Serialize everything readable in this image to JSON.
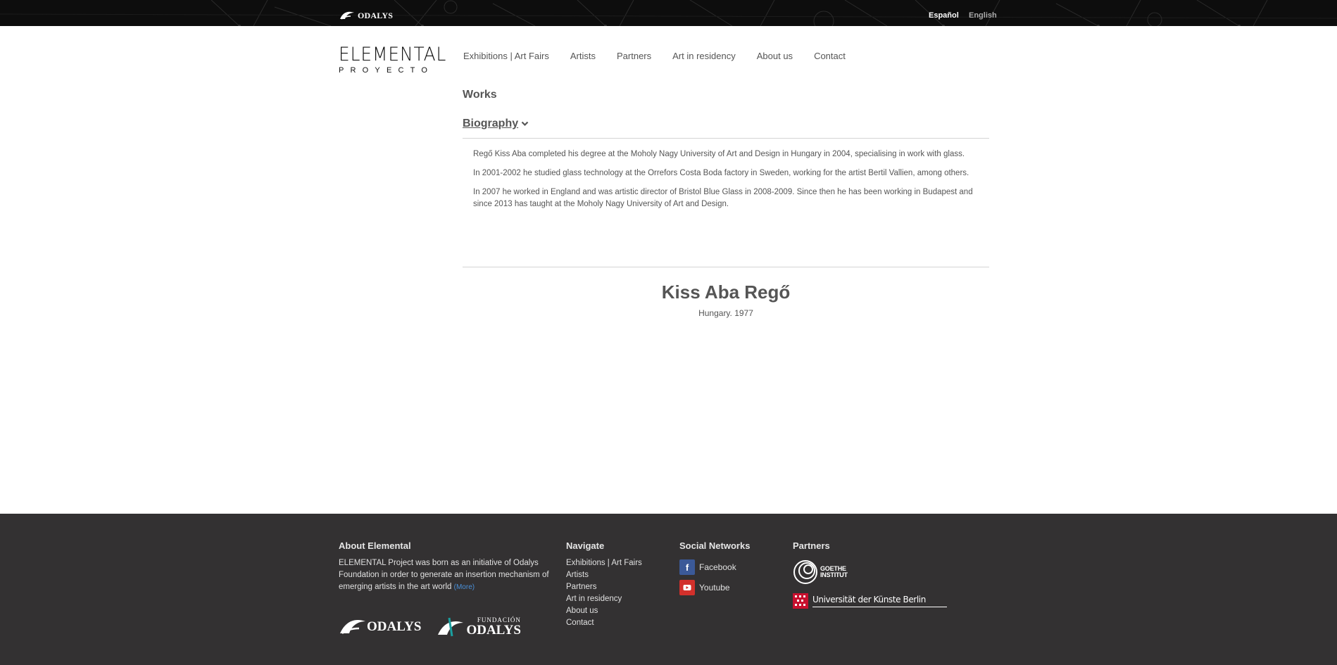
{
  "topbar": {
    "logo_text": "ODALYS",
    "languages": [
      "Español",
      "English"
    ],
    "active_language": "Español"
  },
  "header": {
    "brand_line1": "ELEMENTAL",
    "brand_line2": "PROYECTO",
    "nav": [
      "Exhibitions | Art Fairs",
      "Artists",
      "Partners",
      "Art in residency",
      "About us",
      "Contact"
    ]
  },
  "content": {
    "works_label": "Works",
    "biography_label": "Biography",
    "biography": [
      "Regő Kiss Aba completed his degree at the Moholy Nagy University of Art and Design in Hungary in 2004, specialising in work with glass.",
      "In 2001-2002 he studied glass technology at the Orrefors Costa Boda factory in Sweden, working for the artist Bertil Vallien, among others.",
      "In 2007 he worked in England and was artistic director of Bristol Blue Glass in 2008-2009. Since then he has been working in Budapest and since 2013 has taught at the Moholy Nagy University of Art and Design."
    ],
    "artist_name": "Kiss Aba Regő",
    "artist_origin": "Hungary. 1977"
  },
  "footer": {
    "about": {
      "title": "About Elemental",
      "text": "ELEMENTAL Project was born as an initiative of Odalys Foundation in order to generate an insertion mechanism of emerging artists in the art world",
      "more_label": "(More)"
    },
    "navigate": {
      "title": "Navigate",
      "items": [
        "Exhibitions | Art Fairs",
        "Artists",
        "Partners",
        "Art in residency",
        "About us",
        "Contact"
      ]
    },
    "social": {
      "title": "Social Networks",
      "items": [
        {
          "label": "Facebook",
          "icon": "facebook-icon"
        },
        {
          "label": "Youtube",
          "icon": "youtube-icon"
        }
      ]
    },
    "partners": {
      "title": "Partners",
      "goethe_line1": "GOETHE",
      "goethe_line2": "INSTITUT",
      "udk": "Universität der Künste Berlin"
    },
    "logos": {
      "odalys": "ODALYS",
      "fundacion_small": "FUNDACIÓN",
      "fundacion_big": "ODALYS"
    }
  },
  "colors": {
    "topbar_bg": "#0d0d0d",
    "footer_bg": "#333132",
    "link_blue": "#4a90d9",
    "facebook": "#3b5998",
    "youtube": "#d2302b"
  }
}
